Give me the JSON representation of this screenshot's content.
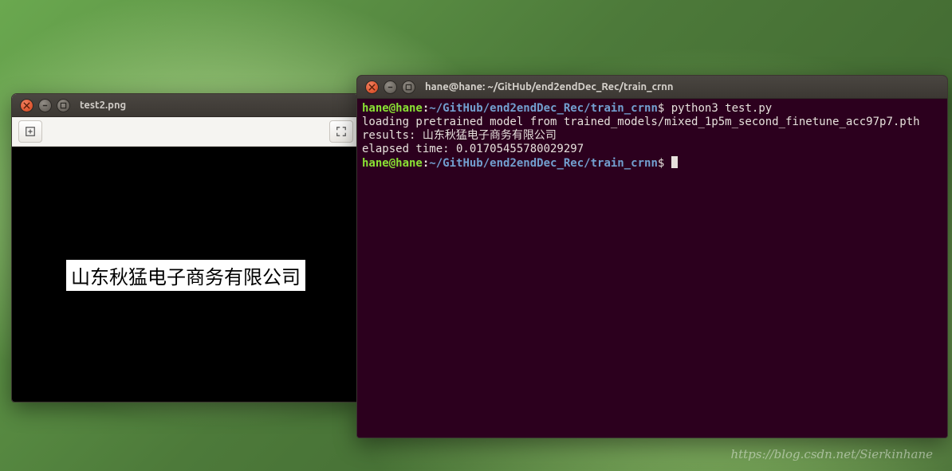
{
  "watermark": "https://blog.csdn.net/Sierkinhane",
  "image_window": {
    "title": "test2.png",
    "toolbar": {
      "zoom_fit_icon": "zoom-fit",
      "fullscreen_icon": "fullscreen"
    },
    "scan_text": "山东秋猛电子商务有限公司"
  },
  "terminal_window": {
    "title": "hane@hane: ~/GitHub/end2endDec_Rec/train_crnn",
    "prompt": {
      "user_host": "hane@hane",
      "sep": ":",
      "path": "~/GitHub/end2endDec_Rec/train_crnn",
      "dollar": "$"
    },
    "lines": {
      "cmd1": " python3 test.py",
      "out1": "loading pretrained model from trained_models/mixed_1p5m_second_finetune_acc97p7.pth",
      "out2_label": "results: ",
      "out2_value": "山东秋猛电子商务有限公司",
      "out3": "elapsed time: 0.01705455780029297"
    }
  }
}
